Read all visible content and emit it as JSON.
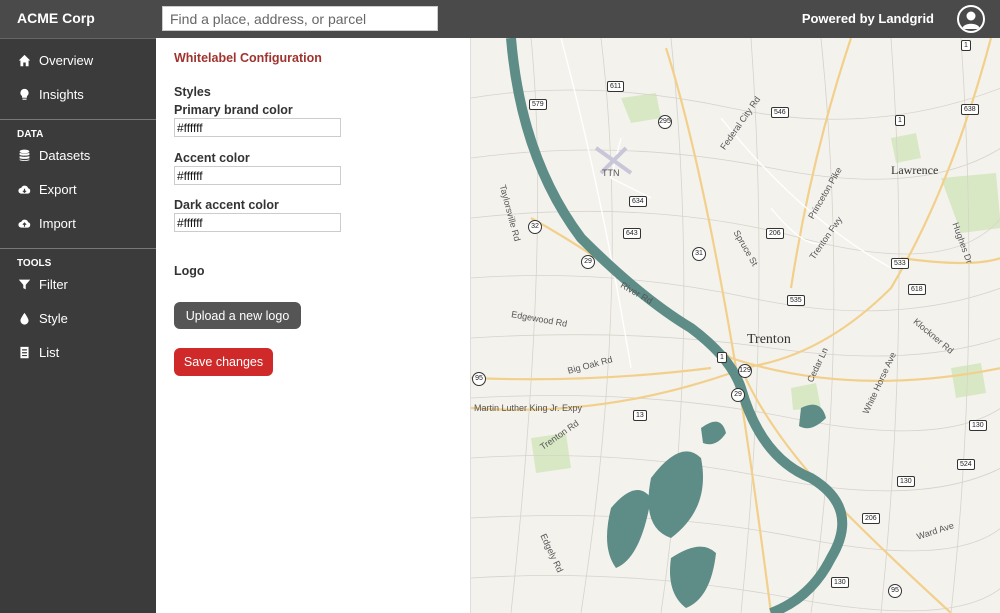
{
  "header": {
    "brand": "ACME Corp",
    "search_placeholder": "Find a place, address, or parcel",
    "powered_by": "Powered by Landgrid"
  },
  "sidebar": {
    "items": [
      {
        "label": "Overview",
        "icon": "home-icon"
      },
      {
        "label": "Insights",
        "icon": "lightbulb-icon"
      }
    ],
    "data_section": "DATA",
    "data_items": [
      {
        "label": "Datasets",
        "icon": "database-icon"
      },
      {
        "label": "Export",
        "icon": "cloud-download-icon"
      },
      {
        "label": "Import",
        "icon": "cloud-upload-icon"
      }
    ],
    "tools_section": "TOOLS",
    "tools_items": [
      {
        "label": "Filter",
        "icon": "filter-icon"
      },
      {
        "label": "Style",
        "icon": "droplet-icon"
      },
      {
        "label": "List",
        "icon": "list-icon"
      }
    ]
  },
  "config": {
    "title": "Whitelabel Configuration",
    "styles_heading": "Styles",
    "primary_label": "Primary brand color",
    "primary_value": "#ffffff",
    "accent_label": "Accent color",
    "accent_value": "#ffffff",
    "dark_accent_label": "Dark accent color",
    "dark_accent_value": "#ffffff",
    "logo_heading": "Logo",
    "upload_label": "Upload a new logo",
    "save_label": "Save changes"
  },
  "map": {
    "cities": [
      "Trenton",
      "Lawrence"
    ],
    "airport": "TTN",
    "roads": [
      "Federal City Rd",
      "Taylorsville Rd",
      "Princeton Pike",
      "Trenton Fwy",
      "Spruce St",
      "Hughes Dr",
      "River Rd",
      "Edgewood Rd",
      "Big Oak Rd",
      "Martin Luther King Jr. Expy",
      "Trenton Rd",
      "Cedar Ln",
      "White Horse Ave",
      "Klockner Rd",
      "Ward Ave",
      "Edgely Rd"
    ],
    "shields": [
      "1",
      "579",
      "611",
      "295",
      "546",
      "638",
      "1",
      "634",
      "32",
      "643",
      "206",
      "31",
      "29",
      "533",
      "618",
      "535",
      "1",
      "129",
      "29",
      "13",
      "130",
      "524",
      "130",
      "206",
      "130",
      "95",
      "95"
    ]
  },
  "colors": {
    "topbar": "#4a4a4a",
    "sidebar": "#3b3b3b",
    "title": "#a0332e",
    "save_button": "#d0292a",
    "upload_button": "#555555",
    "river": "#5e8c86"
  }
}
